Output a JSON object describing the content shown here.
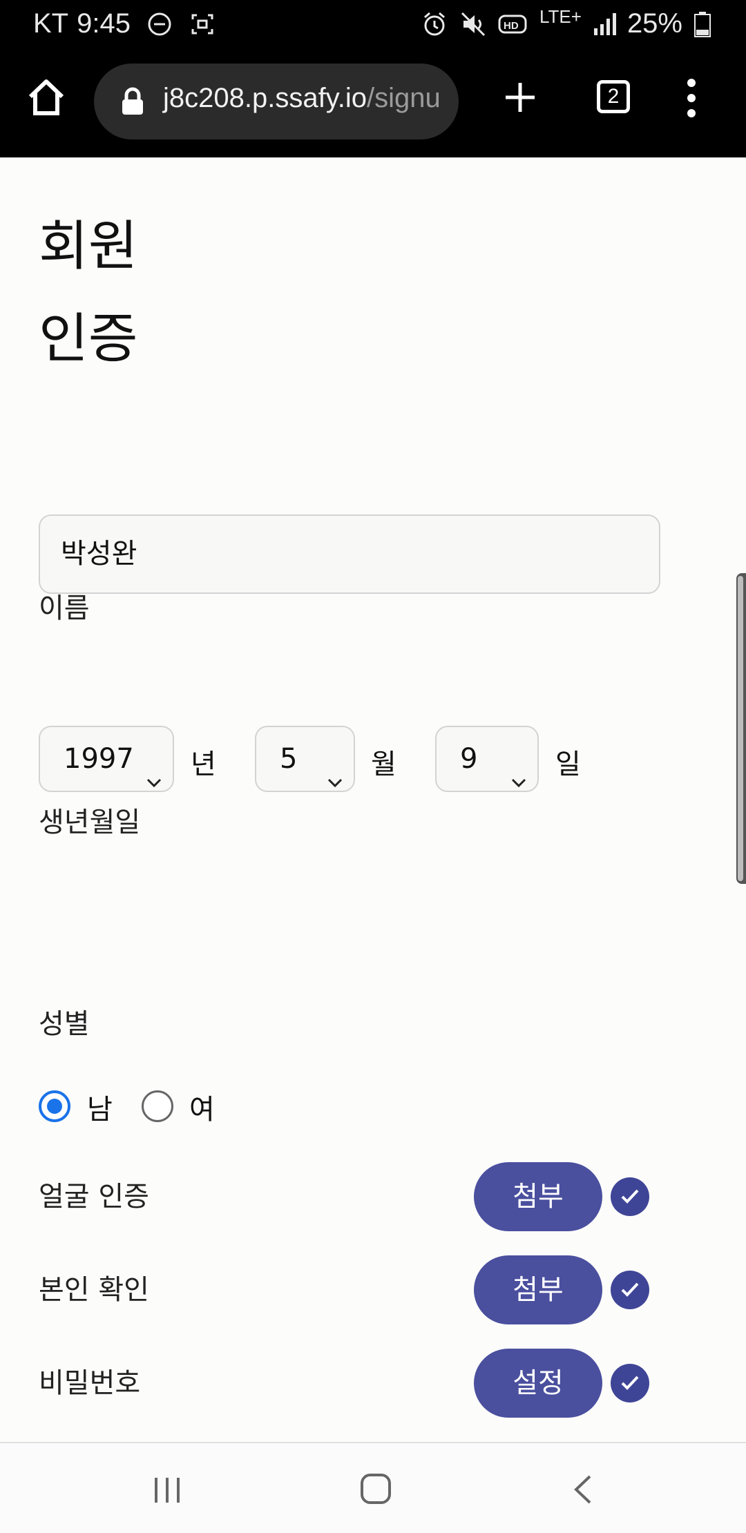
{
  "status_bar": {
    "carrier": "KT",
    "time": "9:45",
    "network": "LTE+",
    "battery": "25%",
    "icons": [
      "dnd-icon",
      "screen-record-icon",
      "alarm-icon",
      "mute-icon",
      "hd-icon",
      "lte-icon",
      "signal-icon",
      "battery-icon"
    ]
  },
  "browser": {
    "url_main": "j8c208.p.ssafy.io",
    "url_rest": "/signu",
    "tab_count": "2"
  },
  "page": {
    "title_line1": "회원",
    "title_line2": "인증",
    "name_label": "이름",
    "name_value": "박성완",
    "birth_label": "생년월일",
    "birth_year": "1997",
    "birth_year_unit": "년",
    "birth_month": "5",
    "birth_month_unit": "월",
    "birth_day": "9",
    "birth_day_unit": "일",
    "gender_label": "성별",
    "gender_male": "남",
    "gender_female": "여",
    "gender_selected": "남",
    "rows": [
      {
        "label": "얼굴 인증",
        "button": "첨부",
        "done": true
      },
      {
        "label": "본인 확인",
        "button": "첨부",
        "done": true
      },
      {
        "label": "비밀번호",
        "button": "설정",
        "done": true
      }
    ]
  },
  "colors": {
    "accent": "#4a4f9e",
    "radio": "#1a73e8"
  }
}
